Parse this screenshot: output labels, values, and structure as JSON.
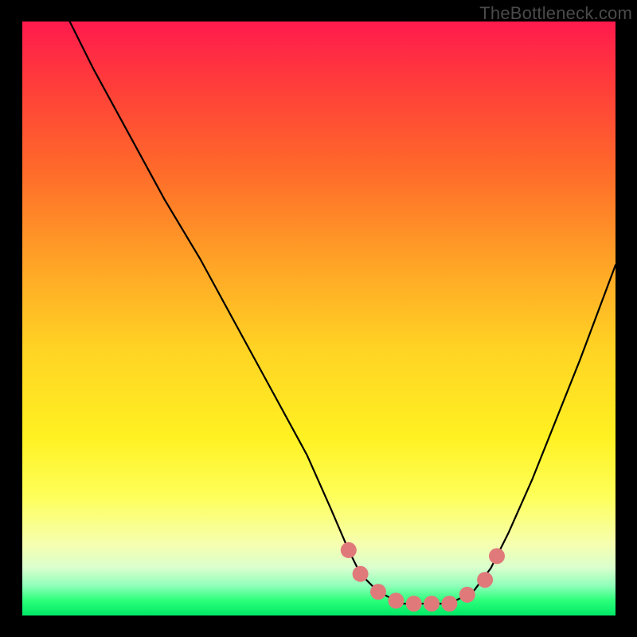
{
  "watermark": "TheBottleneck.com",
  "chart_data": {
    "type": "line",
    "title": "",
    "xlabel": "",
    "ylabel": "",
    "xlim": [
      0,
      100
    ],
    "ylim": [
      0,
      100
    ],
    "series": [
      {
        "name": "curve",
        "x": [
          8,
          12,
          18,
          24,
          30,
          36,
          42,
          48,
          52,
          55,
          57,
          60,
          64,
          68,
          72,
          76,
          79,
          82,
          86,
          90,
          94,
          100
        ],
        "y": [
          100,
          92,
          81,
          70,
          60,
          49,
          38,
          27,
          18,
          11,
          7,
          4,
          2,
          2,
          2,
          4,
          8,
          14,
          23,
          33,
          43,
          59
        ]
      },
      {
        "name": "highlight-dots",
        "x": [
          55,
          57,
          60,
          63,
          66,
          69,
          72,
          75,
          78,
          80
        ],
        "y": [
          11,
          7,
          4,
          2.5,
          2,
          2,
          2,
          3.5,
          6,
          10
        ]
      }
    ],
    "colors": {
      "curve": "#000000",
      "dots": "#e07a7a"
    }
  }
}
